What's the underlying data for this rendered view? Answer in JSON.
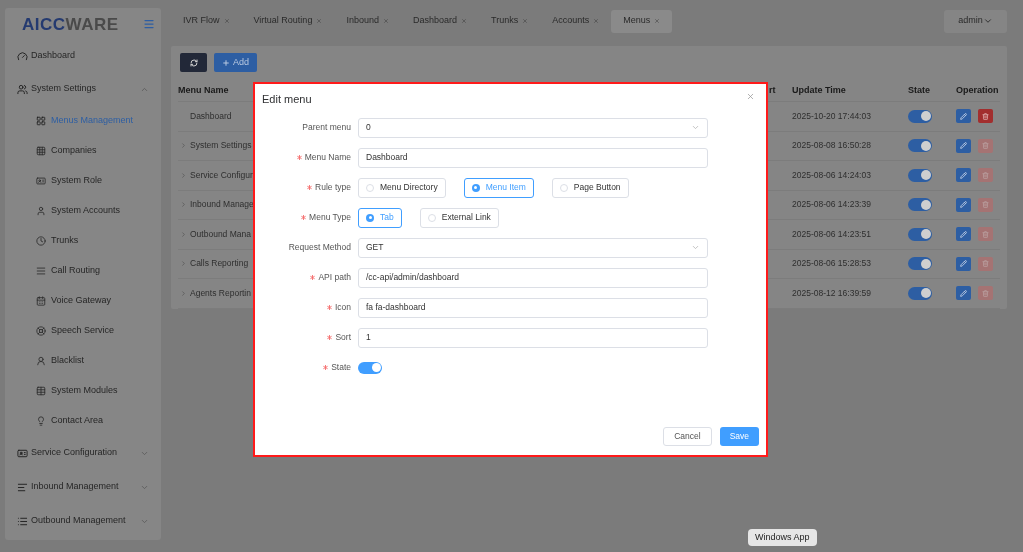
{
  "logo": {
    "part_1": "AICC",
    "part_2": "WARE"
  },
  "sidebar": {
    "items": [
      {
        "label": "Dashboard",
        "kind": "link"
      },
      {
        "label": "System Settings",
        "kind": "group",
        "expanded": true,
        "children": [
          {
            "label": "Menus Management",
            "selected": true
          },
          {
            "label": "Companies",
            "selected": false
          },
          {
            "label": "System Role",
            "selected": false
          },
          {
            "label": "System Accounts",
            "selected": false
          },
          {
            "label": "Trunks",
            "selected": false
          },
          {
            "label": "Call Routing",
            "selected": false
          },
          {
            "label": "Voice Gateway",
            "selected": false
          },
          {
            "label": "Speech Service",
            "selected": false
          },
          {
            "label": "Blacklist",
            "selected": false
          },
          {
            "label": "System Modules",
            "selected": false
          },
          {
            "label": "Contact Area",
            "selected": false
          }
        ]
      },
      {
        "label": "Service Configuration",
        "kind": "group",
        "expanded": false
      },
      {
        "label": "Inbound Management",
        "kind": "group",
        "expanded": false
      },
      {
        "label": "Outbound Management",
        "kind": "group",
        "expanded": false
      }
    ]
  },
  "tabs": [
    {
      "label": "IVR Flow",
      "selected": false
    },
    {
      "label": "Virtual Routing",
      "selected": false
    },
    {
      "label": "Inbound",
      "selected": false
    },
    {
      "label": "Dashboard",
      "selected": false
    },
    {
      "label": "Trunks",
      "selected": false
    },
    {
      "label": "Accounts",
      "selected": false
    },
    {
      "label": "Menus",
      "selected": true
    }
  ],
  "user_menu": {
    "label": "admin"
  },
  "toolbar": {
    "add_button": "Add"
  },
  "table": {
    "columns": [
      "Menu Name",
      "rt",
      "Update Time",
      "State",
      "Operation"
    ],
    "rows": [
      {
        "menu_name": "Dashboard",
        "expandable": false,
        "update_time": "2025-10-20 17:44:03",
        "state": true,
        "delete_disabled": false
      },
      {
        "menu_name": "System Settings",
        "expandable": true,
        "update_time": "2025-08-08 16:50:28",
        "state": true,
        "delete_disabled": true
      },
      {
        "menu_name": "Service Configur",
        "expandable": true,
        "update_time": "2025-08-06 14:24:03",
        "state": true,
        "delete_disabled": true
      },
      {
        "menu_name": "Inbound Manage",
        "expandable": true,
        "update_time": "2025-08-06 14:23:39",
        "state": true,
        "delete_disabled": true
      },
      {
        "menu_name": "Outbound Mana",
        "expandable": true,
        "update_time": "2025-08-06 14:23:51",
        "state": true,
        "delete_disabled": true
      },
      {
        "menu_name": "Calls Reporting",
        "expandable": true,
        "update_time": "2025-08-06 15:28:53",
        "state": true,
        "delete_disabled": true
      },
      {
        "menu_name": "Agents Reportin",
        "expandable": true,
        "update_time": "2025-08-12 16:39:59",
        "state": true,
        "delete_disabled": true
      }
    ]
  },
  "dialog": {
    "title": "Edit menu",
    "fields": [
      {
        "kind": "select",
        "label": "Parent menu",
        "required": false,
        "value": "0"
      },
      {
        "kind": "text",
        "label": "Menu Name",
        "required": true,
        "value": "Dashboard"
      },
      {
        "kind": "radio",
        "label": "Rule type",
        "required": true,
        "options": [
          {
            "label": "Menu Directory",
            "selected": false
          },
          {
            "label": "Menu Item",
            "selected": true
          },
          {
            "label": "Page Button",
            "selected": false
          }
        ]
      },
      {
        "kind": "radio",
        "label": "Menu Type",
        "required": true,
        "options": [
          {
            "label": "Tab",
            "selected": true
          },
          {
            "label": "External Link",
            "selected": false
          }
        ]
      },
      {
        "kind": "select",
        "label": "Request Method",
        "required": false,
        "value": "GET"
      },
      {
        "kind": "text",
        "label": "API path",
        "required": true,
        "value": "/cc-api/admin/dashboard"
      },
      {
        "kind": "text",
        "label": "Icon",
        "required": true,
        "value": "fa fa-dashboard"
      },
      {
        "kind": "text",
        "label": "Sort",
        "required": true,
        "value": "1"
      },
      {
        "kind": "switch",
        "label": "State",
        "required": true,
        "on": true
      }
    ],
    "buttons": [
      {
        "label": "Cancel",
        "kind": "secondary"
      },
      {
        "label": "Save",
        "kind": "primary"
      }
    ]
  },
  "tooltip": {
    "label": "Windows App"
  }
}
